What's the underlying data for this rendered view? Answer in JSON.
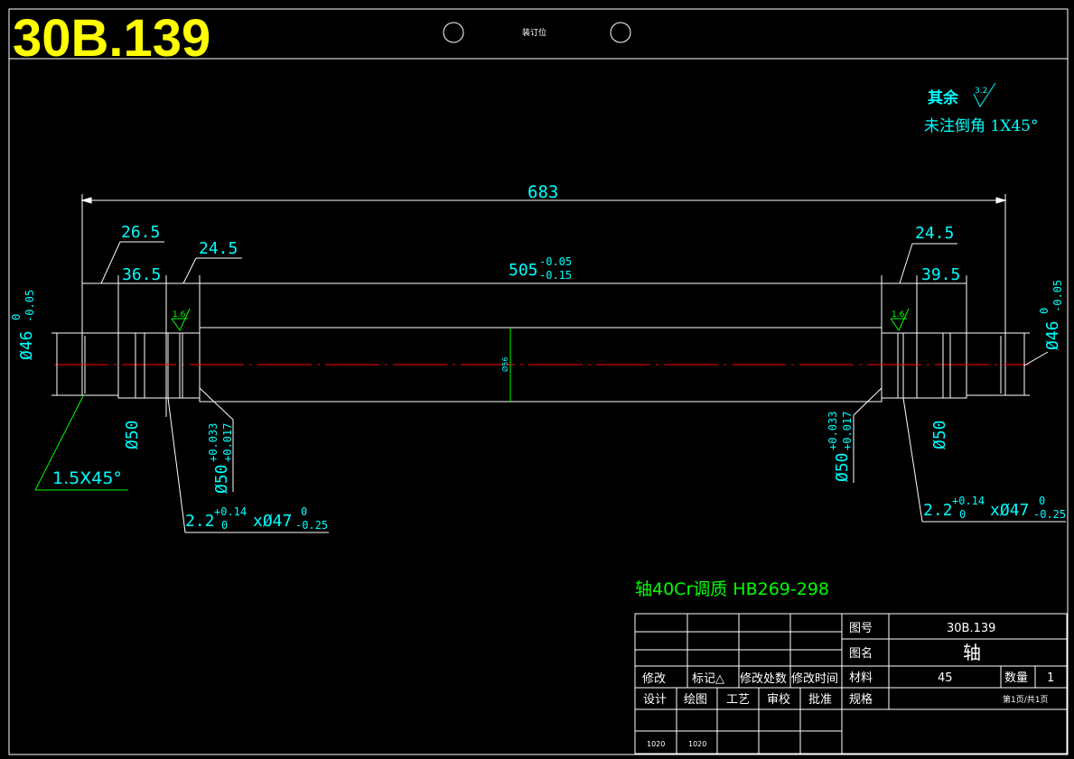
{
  "drawing_number_large": "30B.139",
  "binding_label": "装订位",
  "notes": {
    "roughness_rest_label": "其余",
    "roughness_rest_value": "3.2",
    "chamfer_note": "未注倒角 1X45°"
  },
  "dimensions": {
    "overall_length": "683",
    "left_end_length": "26.5",
    "left_step_length": "36.5",
    "left_groove_length": "24.5",
    "middle_length": "505",
    "middle_tol_upper": "-0.05",
    "middle_tol_lower": "-0.15",
    "right_groove_length": "24.5",
    "right_step_length": "39.5",
    "left_end_dia": "Ø46",
    "left_end_dia_upper": "0",
    "left_end_dia_lower": "-0.05",
    "right_end_dia": "Ø46",
    "right_end_dia_upper": "0",
    "right_end_dia_lower": "-0.05",
    "shaft_center_dia": "Ø56",
    "roughness_left": "1.6",
    "roughness_right": "1.6",
    "left_step_dia": "Ø50",
    "right_step_dia": "Ø50",
    "left_fit_dia": "Ø50",
    "left_fit_upper": "+0.033",
    "left_fit_lower": "+0.017",
    "right_fit_dia": "Ø50",
    "right_fit_upper": "+0.033",
    "right_fit_lower": "+0.017",
    "chamfer_callout": "1.5X45°",
    "groove_left": "2.2",
    "groove_left_upper": "+0.14",
    "groove_left_lower": "0",
    "groove_left_mid": "xØ47",
    "groove_left_dia_upper": "0",
    "groove_left_dia_lower": "-0.25",
    "groove_right": "2.2",
    "groove_right_upper": "+0.14",
    "groove_right_lower": "0",
    "groove_right_mid": "xØ47",
    "groove_right_dia_upper": "0",
    "groove_right_dia_lower": "-0.25"
  },
  "material_note": "轴40Cr调质 HB269-298",
  "title_block": {
    "rev_labels": [
      "修改",
      "标记△",
      "修改处数",
      "修改时间"
    ],
    "sign_labels": [
      "设计",
      "绘图",
      "工艺",
      "审校",
      "批准"
    ],
    "sign_values": [
      "1020",
      "1020"
    ],
    "drawing_no_label": "图号",
    "drawing_no": "30B.139",
    "name_label": "图名",
    "name": "轴",
    "material_label": "材料",
    "material": "45",
    "qty_label": "数量",
    "qty": "1",
    "spec_label": "规格",
    "page": "第1页/共1页"
  }
}
